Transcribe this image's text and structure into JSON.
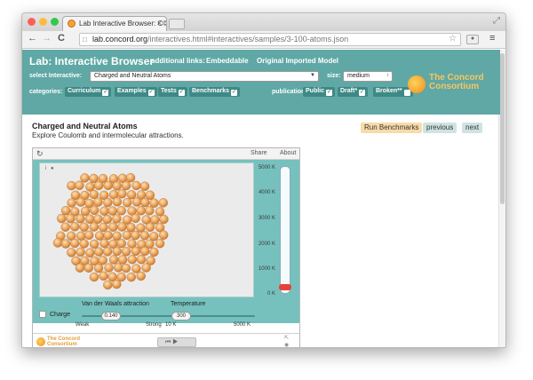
{
  "browser": {
    "tab_title": "Lab Interactive Browser: C©",
    "close_glyph": "×",
    "url_host": "lab.concord.org",
    "url_path": "/interactives.html#interactives/samples/3-100-atoms.json",
    "back_glyph": "←",
    "forward_glyph": "→",
    "reload_glyph": "C",
    "star_glyph": "☆",
    "menu_glyph": "≡",
    "resize_glyph": "⤢",
    "traffic_colors": [
      "#fc605b",
      "#fdbc40",
      "#34c84a"
    ]
  },
  "header": {
    "title": "Lab: Interactive Browser",
    "additional_links_label": "additional links:",
    "links": [
      "Embeddable",
      "Original Imported Model"
    ],
    "select_label": "select Interactive:",
    "selected_interactive": "Charged and Neutral Atoms",
    "size_label": "size:",
    "size_value": "medium",
    "categories_label": "categories:",
    "categories": [
      {
        "label": "Curriculum",
        "checked": true
      },
      {
        "label": "Examples",
        "checked": true
      },
      {
        "label": "Tests",
        "checked": true
      },
      {
        "label": "Benchmarks",
        "checked": true
      }
    ],
    "publication_label": "publication status:",
    "statuses": [
      {
        "label": "Public",
        "checked": true
      },
      {
        "label": "Draft*",
        "checked": true
      },
      {
        "label": "Broken**",
        "checked": false
      }
    ],
    "logo_line1": "The Concord",
    "logo_line2": "Consortium",
    "bg_color": "#5fa8a5"
  },
  "content": {
    "title": "Charged and Neutral Atoms",
    "subtitle": "Explore Coulomb and intermolecular attractions.",
    "buttons": [
      "Run Benchmarks",
      "previous",
      "next"
    ]
  },
  "interactive": {
    "share_label": "Share",
    "about_label": "About",
    "info_glyph": "i",
    "thermometer_labels": [
      "5000 K",
      "4000 K",
      "3000 K",
      "2000 K",
      "1000 K",
      "0 K"
    ],
    "charge_label": "Charge",
    "vdw_label": "Van der Waals attraction",
    "vdw_value": "0.140",
    "vdw_min": "Weak",
    "vdw_max": "Strong",
    "temp_label": "Temperature",
    "temp_value": "300",
    "temp_min": "10 K",
    "temp_max": "5000 K",
    "player_glyphs": "⏮ ▶",
    "footer_logo_line1": "The Concord",
    "footer_logo_line2": "Consortium",
    "atom_count": 165
  }
}
